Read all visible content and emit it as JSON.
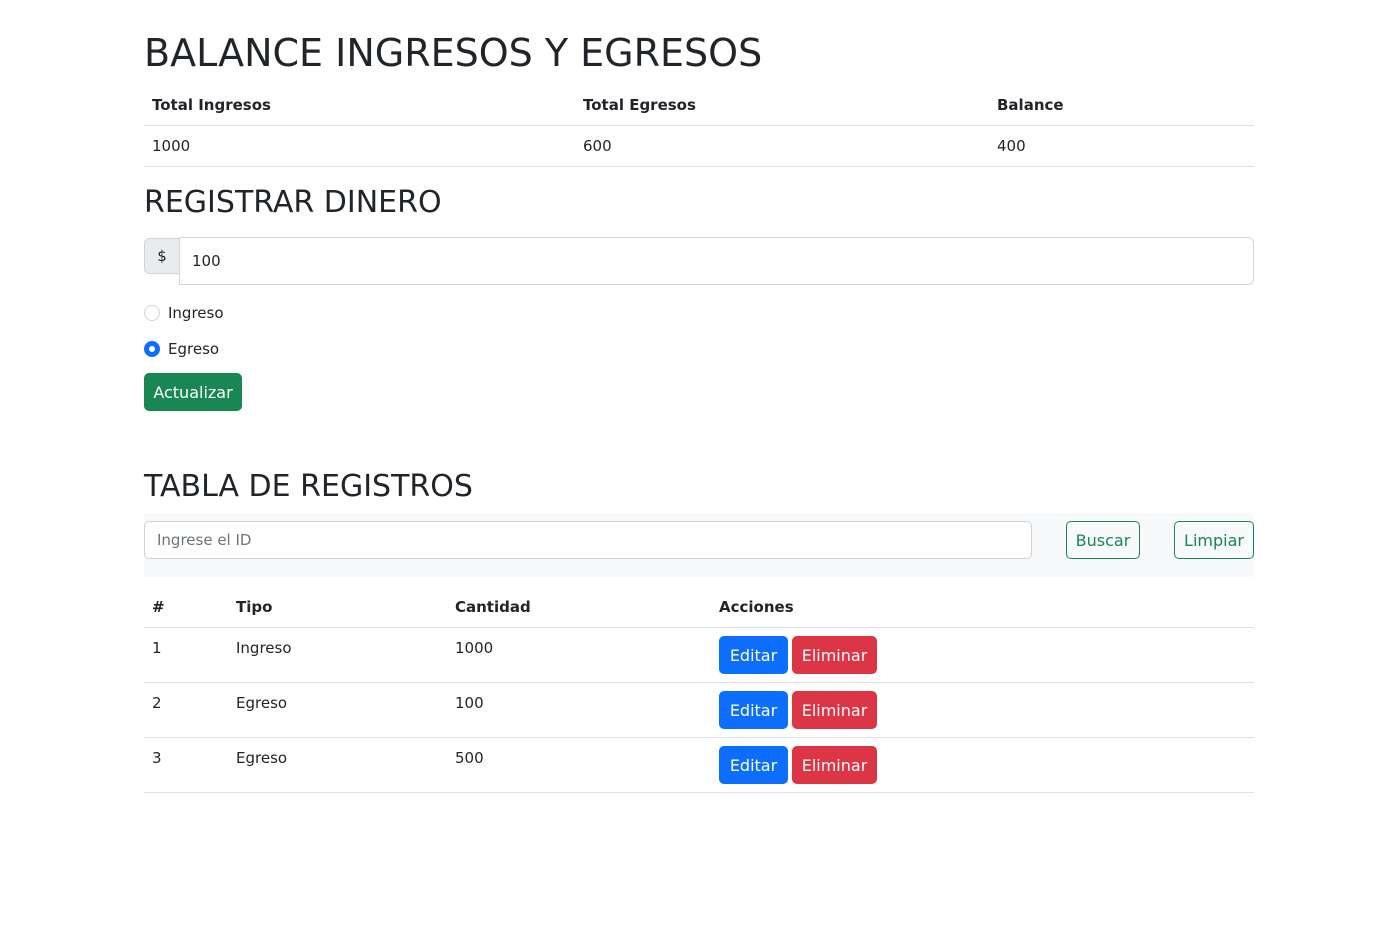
{
  "balance": {
    "title": "BALANCE INGRESOS Y EGRESOS",
    "headers": [
      "Total Ingresos",
      "Total Egresos",
      "Balance"
    ],
    "values": [
      "1000",
      "600",
      "400"
    ]
  },
  "registrar": {
    "title": "REGISTRAR DINERO",
    "currency_symbol": "$",
    "amount_value": "100",
    "radio_options": [
      {
        "label": "Ingreso",
        "checked": false
      },
      {
        "label": "Egreso",
        "checked": true
      }
    ],
    "submit_label": "Actualizar"
  },
  "tabla": {
    "title": "TABLA DE REGISTROS",
    "search_placeholder": "Ingrese el ID",
    "search_value": "",
    "search_button": "Buscar",
    "clear_button": "Limpiar",
    "columns": [
      "#",
      "Tipo",
      "Cantidad",
      "Acciones"
    ],
    "rows": [
      {
        "id": "1",
        "tipo": "Ingreso",
        "cantidad": "1000"
      },
      {
        "id": "2",
        "tipo": "Egreso",
        "cantidad": "100"
      },
      {
        "id": "3",
        "tipo": "Egreso",
        "cantidad": "500"
      }
    ],
    "edit_label": "Editar",
    "delete_label": "Eliminar"
  },
  "colors": {
    "success": "#198754",
    "primary": "#0d6efd",
    "danger": "#dc3545",
    "text": "#212529",
    "border": "#dee2e6"
  }
}
